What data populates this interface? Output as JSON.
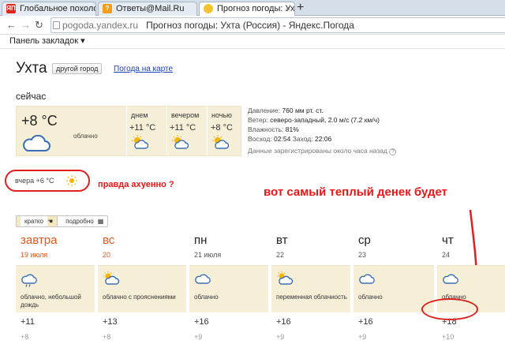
{
  "browser": {
    "tabs": [
      {
        "label": "Глобальное похолод",
        "fav": "ЯП"
      },
      {
        "label": "Ответы@Mail.Ru",
        "fav": "?"
      },
      {
        "label": "Прогноз погоды: Ухта",
        "fav": ""
      }
    ],
    "address": {
      "domain": "pogoda.yandex.ru",
      "title": "Прогноз погоды: Ухта (Россия) - Яндекс.Погода"
    },
    "bookmarks_label": "Панель закладок ▾"
  },
  "header": {
    "city": "Ухта",
    "other_city": "другой город",
    "map_link": "Погода на карте"
  },
  "now": {
    "title": "сейчас",
    "temp": "+8 °C",
    "condition": "облачно",
    "parts": [
      {
        "label": "днем",
        "temp": "+11 °C"
      },
      {
        "label": "вечером",
        "temp": "+11 °C"
      },
      {
        "label": "ночью",
        "temp": "+8 °C"
      }
    ],
    "details": {
      "pressure_label": "Давление:",
      "pressure": "760 мм рт. ст.",
      "wind_label": "Ветер:",
      "wind": "северо-западный, 2.0 м/с (7.2 км/ч)",
      "humidity_label": "Влажность:",
      "humidity": "81%",
      "sun_label": "Восход:",
      "sunrise": "02:54",
      "sunset_label": "Заход:",
      "sunset": "22:06",
      "updated": "Данные зарегистрированы около часа назад"
    }
  },
  "yesterday": "вчера +6 °C",
  "annotations": {
    "first": "правда ахуенно ?",
    "second": "вот самый теплый денек будет"
  },
  "view_tabs": {
    "short": "кратко",
    "detailed": "подробно"
  },
  "forecast": [
    {
      "day": "завтра",
      "date": "19 июля",
      "desc": "облачно, небольшой дождь",
      "hi": "+11",
      "lo": "+8",
      "weekend": true
    },
    {
      "day": "вс",
      "date": "20",
      "desc": "облачно с прояснениями",
      "hi": "+13",
      "lo": "+8",
      "weekend": true
    },
    {
      "day": "пн",
      "date": "21 июля",
      "desc": "облачно",
      "hi": "+16",
      "lo": "+9",
      "weekend": false
    },
    {
      "day": "вт",
      "date": "22",
      "desc": "переменная облачность",
      "hi": "+16",
      "lo": "+9",
      "weekend": false
    },
    {
      "day": "ср",
      "date": "23",
      "desc": "облачно",
      "hi": "+16",
      "lo": "+9",
      "weekend": false
    },
    {
      "day": "чт",
      "date": "24",
      "desc": "облачно",
      "hi": "+18",
      "lo": "+10",
      "weekend": false
    }
  ],
  "colors": {
    "weekend": "#e8561c",
    "accent_box": "#f6efd8",
    "annotation": "#ee1515",
    "link": "#1a3dc1"
  }
}
